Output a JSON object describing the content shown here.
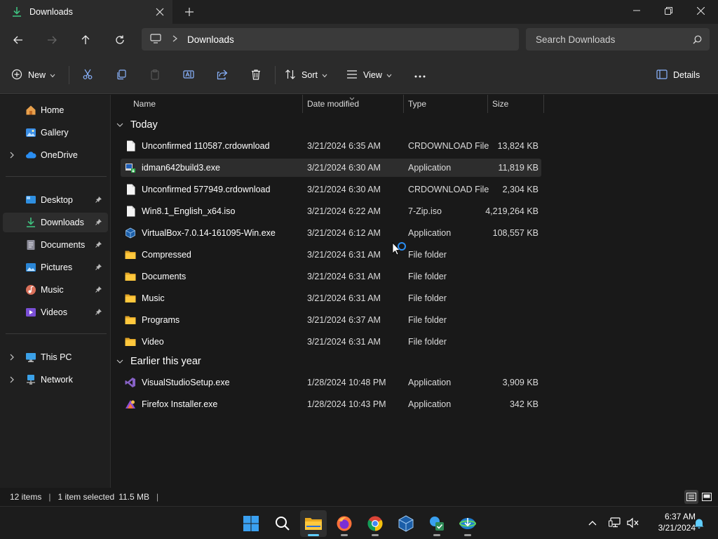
{
  "window": {
    "tab_title": "Downloads",
    "accent": "#60cdff"
  },
  "address": {
    "crumb": "Downloads",
    "search_placeholder": "Search Downloads"
  },
  "commands": {
    "new_label": "New",
    "sort_label": "Sort",
    "view_label": "View",
    "details_label": "Details"
  },
  "sidebar": {
    "items": [
      {
        "label": "Home",
        "icon": "home-icon"
      },
      {
        "label": "Gallery",
        "icon": "gallery-icon"
      },
      {
        "label": "OneDrive",
        "icon": "cloud-icon"
      },
      {
        "label": "Desktop",
        "icon": "desktop-icon"
      },
      {
        "label": "Downloads",
        "icon": "download-icon"
      },
      {
        "label": "Documents",
        "icon": "documents-icon"
      },
      {
        "label": "Pictures",
        "icon": "pictures-icon"
      },
      {
        "label": "Music",
        "icon": "music-icon"
      },
      {
        "label": "Videos",
        "icon": "videos-icon"
      },
      {
        "label": "This PC",
        "icon": "pc-icon"
      },
      {
        "label": "Network",
        "icon": "network-icon"
      }
    ]
  },
  "columns": {
    "name": "Name",
    "date": "Date modified",
    "type": "Type",
    "size": "Size"
  },
  "groups": {
    "today": "Today",
    "earlier": "Earlier this year"
  },
  "files": [
    {
      "name": "Unconfirmed 110587.crdownload",
      "date": "3/21/2024 6:35 AM",
      "type": "CRDOWNLOAD File",
      "size": "13,824 KB",
      "icon": "file-icon"
    },
    {
      "name": "idman642build3.exe",
      "date": "3/21/2024 6:30 AM",
      "type": "Application",
      "size": "11,819 KB",
      "icon": "idm-installer-icon"
    },
    {
      "name": "Unconfirmed 577949.crdownload",
      "date": "3/21/2024 6:30 AM",
      "type": "CRDOWNLOAD File",
      "size": "2,304 KB",
      "icon": "file-icon"
    },
    {
      "name": "Win8.1_English_x64.iso",
      "date": "3/21/2024 6:22 AM",
      "type": "7-Zip.iso",
      "size": "4,219,264 KB",
      "icon": "file-icon"
    },
    {
      "name": "VirtualBox-7.0.14-161095-Win.exe",
      "date": "3/21/2024 6:12 AM",
      "type": "Application",
      "size": "108,557 KB",
      "icon": "virtualbox-icon"
    },
    {
      "name": "Compressed",
      "date": "3/21/2024 6:31 AM",
      "type": "File folder",
      "size": "",
      "icon": "folder-icon"
    },
    {
      "name": "Documents",
      "date": "3/21/2024 6:31 AM",
      "type": "File folder",
      "size": "",
      "icon": "folder-icon"
    },
    {
      "name": "Music",
      "date": "3/21/2024 6:31 AM",
      "type": "File folder",
      "size": "",
      "icon": "folder-icon"
    },
    {
      "name": "Programs",
      "date": "3/21/2024 6:37 AM",
      "type": "File folder",
      "size": "",
      "icon": "folder-icon"
    },
    {
      "name": "Video",
      "date": "3/21/2024 6:31 AM",
      "type": "File folder",
      "size": "",
      "icon": "folder-icon"
    },
    {
      "name": "VisualStudioSetup.exe",
      "date": "1/28/2024 10:48 PM",
      "type": "Application",
      "size": "3,909 KB",
      "icon": "visual-studio-icon"
    },
    {
      "name": "Firefox Installer.exe",
      "date": "1/28/2024 10:43 PM",
      "type": "Application",
      "size": "342 KB",
      "icon": "firefox-installer-icon"
    }
  ],
  "status": {
    "count": "12 items",
    "selection": "1 item selected",
    "selection_size": "11.5 MB"
  },
  "clock": {
    "time": "6:37 AM",
    "date": "3/21/2024"
  }
}
